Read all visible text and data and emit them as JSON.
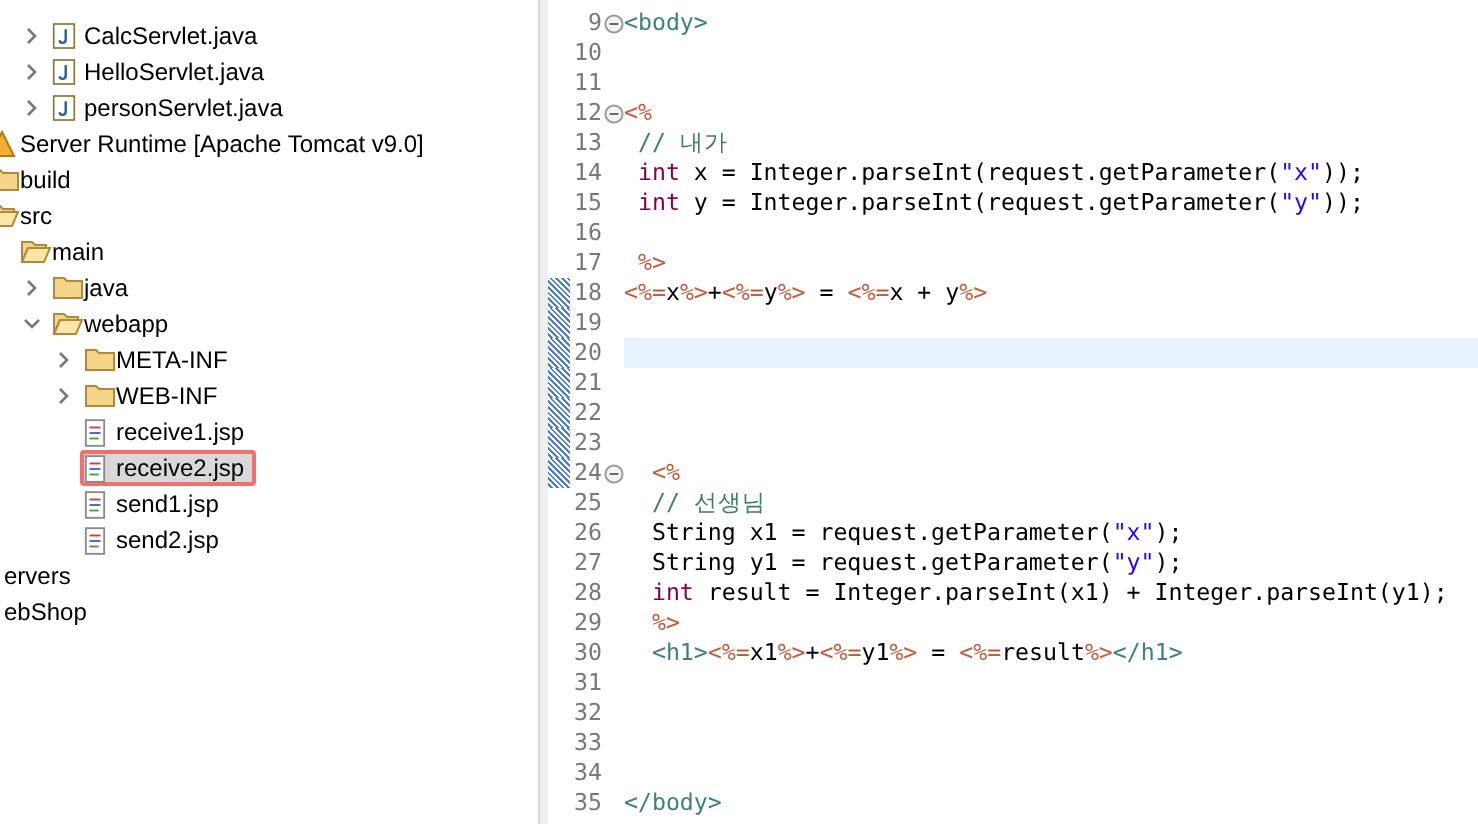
{
  "tree": {
    "upper_files": [
      {
        "label": "CalcServlet.java",
        "kind": "java",
        "expanded": false,
        "selected": false
      },
      {
        "label": "HelloServlet.java",
        "kind": "java",
        "expanded": false,
        "selected": false
      },
      {
        "label": "personServlet.java",
        "kind": "java",
        "expanded": false,
        "selected": false
      }
    ],
    "items": [
      {
        "label": "Server Runtime [Apache Tomcat v9.0]",
        "kind": "library",
        "selected": false
      },
      {
        "label": "build",
        "kind": "folder",
        "selected": false
      },
      {
        "label": "src",
        "kind": "folder",
        "selected": false,
        "children": [
          {
            "label": "main",
            "kind": "folder",
            "selected": false,
            "children": [
              {
                "label": "java",
                "kind": "folder",
                "expanded": false,
                "selected": false
              },
              {
                "label": "webapp",
                "kind": "folder",
                "expanded": true,
                "selected": false,
                "children": [
                  {
                    "label": "META-INF",
                    "kind": "folder",
                    "expanded": false,
                    "selected": false
                  },
                  {
                    "label": "WEB-INF",
                    "kind": "folder",
                    "expanded": false,
                    "selected": false
                  },
                  {
                    "label": "receive1.jsp",
                    "kind": "jsp",
                    "selected": false
                  },
                  {
                    "label": "receive2.jsp",
                    "kind": "jsp",
                    "selected": true
                  },
                  {
                    "label": "send1.jsp",
                    "kind": "jsp",
                    "selected": false
                  },
                  {
                    "label": "send2.jsp",
                    "kind": "jsp",
                    "selected": false
                  }
                ]
              }
            ]
          }
        ]
      },
      {
        "label": "ervers",
        "kind": "project",
        "level_zero": true,
        "selected": false
      },
      {
        "label": "ebShop",
        "kind": "project",
        "level_zero": true,
        "selected": false
      }
    ]
  },
  "editor": {
    "lines": [
      {
        "number": "9",
        "fold": true,
        "changed": false,
        "current": false,
        "tokens": [
          {
            "kind": "tag",
            "text": "<body>"
          }
        ]
      },
      {
        "number": "10",
        "fold": false,
        "changed": false,
        "current": false
      },
      {
        "number": "11",
        "fold": false,
        "changed": false,
        "current": false
      },
      {
        "number": "12",
        "fold": true,
        "changed": false,
        "current": false,
        "tokens": [
          {
            "kind": "jsp",
            "text": "<%"
          }
        ]
      },
      {
        "number": "13",
        "fold": false,
        "changed": false,
        "current": false,
        "tokens": [
          {
            "kind": "comment",
            "text": " // 내가"
          }
        ]
      },
      {
        "number": "14",
        "fold": false,
        "changed": false,
        "current": false,
        "tokens": [
          {
            "kind": "keyword",
            "text": " int"
          },
          {
            "kind": "plain",
            "text": " x = Integer.parseInt(request.getParameter("
          },
          {
            "kind": "string",
            "text": "\"x\""
          },
          {
            "kind": "plain",
            "text": "));"
          }
        ]
      },
      {
        "number": "15",
        "fold": false,
        "changed": false,
        "current": false,
        "tokens": [
          {
            "kind": "keyword",
            "text": " int"
          },
          {
            "kind": "plain",
            "text": " y = Integer.parseInt(request.getParameter("
          },
          {
            "kind": "string",
            "text": "\"y\""
          },
          {
            "kind": "plain",
            "text": "));"
          }
        ]
      },
      {
        "number": "16",
        "fold": false,
        "changed": false,
        "current": false
      },
      {
        "number": "17",
        "fold": false,
        "changed": false,
        "current": false,
        "tokens": [
          {
            "kind": "jsp",
            "text": " %>"
          }
        ]
      },
      {
        "number": "18",
        "fold": false,
        "changed": true,
        "current": false,
        "tokens": [
          {
            "kind": "jsp",
            "text": "<%="
          },
          {
            "kind": "plain",
            "text": "x"
          },
          {
            "kind": "jsp",
            "text": "%>"
          },
          {
            "kind": "plain",
            "text": "+"
          },
          {
            "kind": "jsp",
            "text": "<%="
          },
          {
            "kind": "plain",
            "text": "y"
          },
          {
            "kind": "jsp",
            "text": "%>"
          },
          {
            "kind": "plain",
            "text": " = "
          },
          {
            "kind": "jsp",
            "text": "<%="
          },
          {
            "kind": "plain",
            "text": "x + y"
          },
          {
            "kind": "jsp",
            "text": "%>"
          }
        ]
      },
      {
        "number": "19",
        "fold": false,
        "changed": true,
        "current": false
      },
      {
        "number": "20",
        "fold": false,
        "changed": true,
        "current": true
      },
      {
        "number": "21",
        "fold": false,
        "changed": true,
        "current": false
      },
      {
        "number": "22",
        "fold": false,
        "changed": true,
        "current": false
      },
      {
        "number": "23",
        "fold": false,
        "changed": true,
        "current": false
      },
      {
        "number": "24",
        "fold": true,
        "changed": true,
        "current": false,
        "tokens": [
          {
            "kind": "jsp",
            "text": "  <%"
          }
        ]
      },
      {
        "number": "25",
        "fold": false,
        "changed": false,
        "current": false,
        "tokens": [
          {
            "kind": "comment",
            "text": "  // 선생님"
          }
        ]
      },
      {
        "number": "26",
        "fold": false,
        "changed": false,
        "current": false,
        "tokens": [
          {
            "kind": "plain",
            "text": "  String x1 = request.getParameter("
          },
          {
            "kind": "string",
            "text": "\"x\""
          },
          {
            "kind": "plain",
            "text": ");"
          }
        ]
      },
      {
        "number": "27",
        "fold": false,
        "changed": false,
        "current": false,
        "tokens": [
          {
            "kind": "plain",
            "text": "  String y1 = request.getParameter("
          },
          {
            "kind": "string",
            "text": "\"y\""
          },
          {
            "kind": "plain",
            "text": ");"
          }
        ]
      },
      {
        "number": "28",
        "fold": false,
        "changed": false,
        "current": false,
        "tokens": [
          {
            "kind": "keyword",
            "text": "  int"
          },
          {
            "kind": "plain",
            "text": " result = Integer.parseInt(x1) + Integer.parseInt(y1);"
          }
        ]
      },
      {
        "number": "29",
        "fold": false,
        "changed": false,
        "current": false,
        "tokens": [
          {
            "kind": "jsp",
            "text": "  %>"
          }
        ]
      },
      {
        "number": "30",
        "fold": false,
        "changed": false,
        "current": false,
        "tokens": [
          {
            "kind": "tag",
            "text": "  <h1>"
          },
          {
            "kind": "jsp",
            "text": "<%="
          },
          {
            "kind": "plain",
            "text": "x1"
          },
          {
            "kind": "jsp",
            "text": "%>"
          },
          {
            "kind": "plain",
            "text": "+"
          },
          {
            "kind": "jsp",
            "text": "<%="
          },
          {
            "kind": "plain",
            "text": "y1"
          },
          {
            "kind": "jsp",
            "text": "%>"
          },
          {
            "kind": "plain",
            "text": " = "
          },
          {
            "kind": "jsp",
            "text": "<%="
          },
          {
            "kind": "plain",
            "text": "result"
          },
          {
            "kind": "jsp",
            "text": "%>"
          },
          {
            "kind": "tag",
            "text": "</h1>"
          }
        ]
      },
      {
        "number": "31",
        "fold": false,
        "changed": false,
        "current": false
      },
      {
        "number": "32",
        "fold": false,
        "changed": false,
        "current": false
      },
      {
        "number": "33",
        "fold": false,
        "changed": false,
        "current": false
      },
      {
        "number": "34",
        "fold": false,
        "changed": false,
        "current": false
      },
      {
        "number": "35",
        "fold": false,
        "changed": false,
        "current": false,
        "tokens": [
          {
            "kind": "tag",
            "text": "</body>"
          }
        ]
      }
    ]
  }
}
